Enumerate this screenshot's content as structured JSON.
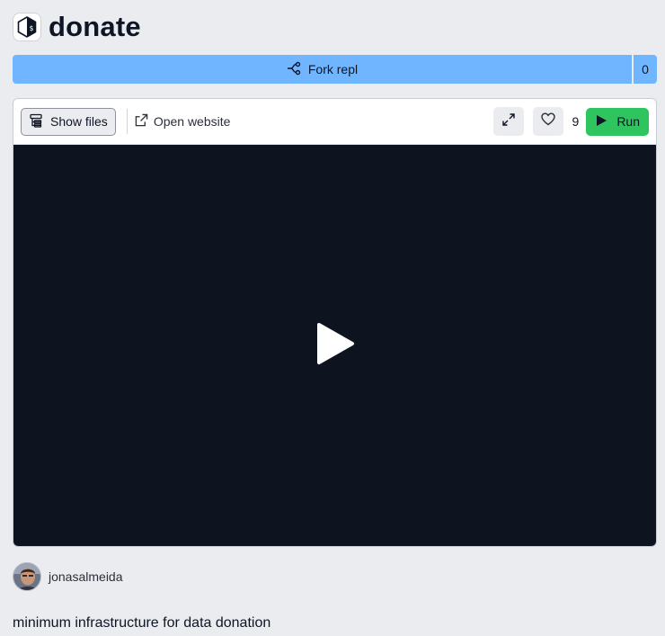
{
  "header": {
    "title": "donate",
    "icon": "bash-repl-icon"
  },
  "fork": {
    "label": "Fork repl",
    "count": "0",
    "icon": "fork-icon",
    "color": "#6fb5ff"
  },
  "toolbar": {
    "show_files_label": "Show files",
    "open_website_label": "Open website",
    "like_count": "9",
    "run_label": "Run",
    "run_color": "#2ec55f"
  },
  "preview": {
    "background": "#0e1320",
    "icon": "play-icon"
  },
  "author": {
    "name": "jonasalmeida"
  },
  "description": "minimum infrastructure for data donation"
}
